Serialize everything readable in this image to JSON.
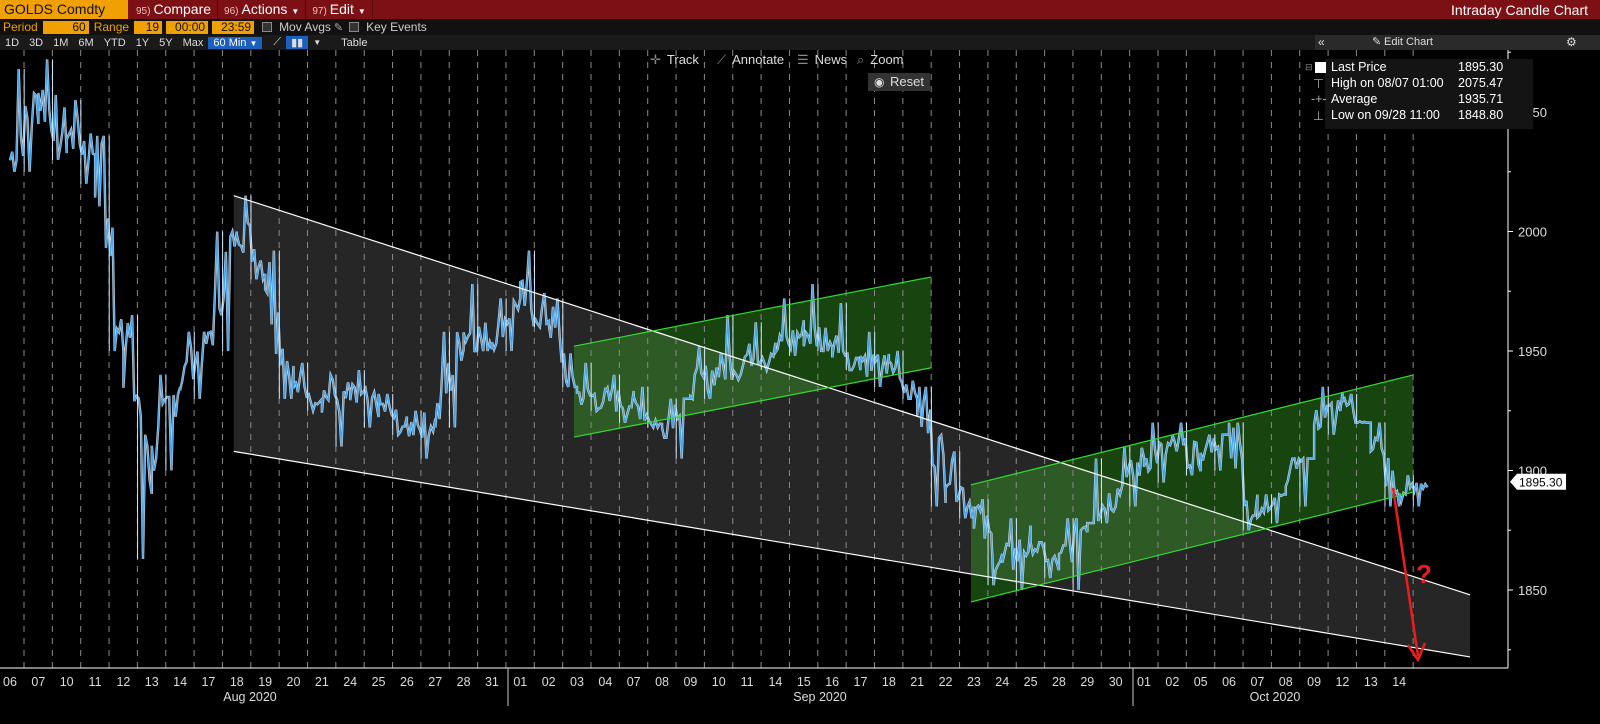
{
  "toolbar": {
    "ticker": "GOLDS Comdty",
    "compare_num": "95)",
    "compare_label": "Compare",
    "actions_num": "96)",
    "actions_label": "Actions",
    "edit_num": "97)",
    "edit_label": "Edit",
    "chart_name": "Intraday Candle Chart"
  },
  "settings": {
    "period_label": "Period",
    "period_value": "60",
    "range_label": "Range",
    "range_value": "19",
    "time_start": "00:00",
    "time_end": "23:59",
    "mov_avgs": "Mov Avgs",
    "key_events": "Key Events"
  },
  "ranges": [
    "1D",
    "3D",
    "1M",
    "6M",
    "YTD",
    "1Y",
    "5Y",
    "Max"
  ],
  "selected_range": "60 Min",
  "table_label": "Table",
  "edit_chart_label": "Edit Chart",
  "tools": {
    "track": "Track",
    "annotate": "Annotate",
    "news": "News",
    "zoom": "Zoom",
    "reset": "Reset"
  },
  "legend": {
    "last_label": "Last Price",
    "last_value": "1895.30",
    "high_label": "High on 08/07 01:00",
    "high_value": "2075.47",
    "avg_label": "Average",
    "avg_value": "1935.71",
    "low_label": "Low on 09/28 11:00",
    "low_value": "1848.80"
  },
  "annotation_mark": "?",
  "colors": {
    "price_line": "#4aa3e8",
    "highlight": "#ffffff",
    "channel_main": "#ffffff",
    "channel_green": "#33dd33",
    "arrow": "#ee1c1c",
    "toolbar_bg": "#7d1014",
    "accent": "#f0a000"
  },
  "chart_data": {
    "type": "line",
    "ylim": [
      1820,
      2075
    ],
    "yticks": [
      1850,
      1900,
      1950,
      2000,
      2050
    ],
    "last_price": 1895.3,
    "months": [
      "Aug 2020",
      "Sep 2020",
      "Oct 2020"
    ],
    "x": [
      "06",
      "07",
      "10",
      "11",
      "12",
      "13",
      "14",
      "17",
      "18",
      "19",
      "20",
      "21",
      "24",
      "25",
      "26",
      "27",
      "28",
      "31",
      "01",
      "02",
      "03",
      "04",
      "07",
      "08",
      "09",
      "10",
      "11",
      "14",
      "15",
      "16",
      "17",
      "18",
      "21",
      "22",
      "23",
      "24",
      "25",
      "28",
      "29",
      "30",
      "01",
      "02",
      "05",
      "06",
      "07",
      "08",
      "09",
      "12",
      "13",
      "14"
    ],
    "open": [
      2030,
      2058,
      2040,
      2035,
      1960,
      1905,
      1938,
      1955,
      2005,
      1985,
      1935,
      1932,
      1930,
      1928,
      1918,
      1920,
      1958,
      1955,
      1972,
      1965,
      1932,
      1930,
      1928,
      1918,
      1935,
      1942,
      1948,
      1950,
      1958,
      1955,
      1942,
      1945,
      1930,
      1900,
      1885,
      1860,
      1870,
      1860,
      1880,
      1890,
      1905,
      1910,
      1905,
      1918,
      1880,
      1895,
      1920,
      1928,
      1915,
      1888
    ],
    "high": [
      2068,
      2072,
      2055,
      2040,
      1965,
      1940,
      1958,
      2000,
      2015,
      1992,
      1945,
      1940,
      1942,
      1932,
      1925,
      1958,
      1978,
      1972,
      1992,
      1972,
      1945,
      1940,
      1935,
      1930,
      1952,
      1965,
      1962,
      1972,
      1978,
      1970,
      1958,
      1950,
      1935,
      1908,
      1888,
      1880,
      1870,
      1880,
      1905,
      1910,
      1920,
      1920,
      1915,
      1920,
      1890,
      1905,
      1935,
      1932,
      1920,
      1898
    ],
    "low": [
      2025,
      2030,
      2020,
      1950,
      1863,
      1900,
      1930,
      1950,
      1980,
      1930,
      1925,
      1910,
      1918,
      1915,
      1905,
      1918,
      1950,
      1950,
      1960,
      1935,
      1925,
      1920,
      1918,
      1905,
      1930,
      1938,
      1942,
      1948,
      1950,
      1942,
      1935,
      1930,
      1885,
      1880,
      1852,
      1850,
      1855,
      1850,
      1878,
      1885,
      1895,
      1898,
      1900,
      1875,
      1878,
      1885,
      1915,
      1920,
      1885,
      1885
    ],
    "close": [
      2055,
      2040,
      2035,
      1960,
      1905,
      1938,
      1955,
      2005,
      1985,
      1935,
      1932,
      1930,
      1928,
      1918,
      1920,
      1958,
      1955,
      1972,
      1965,
      1932,
      1930,
      1928,
      1918,
      1935,
      1942,
      1948,
      1950,
      1958,
      1955,
      1942,
      1945,
      1930,
      1900,
      1885,
      1860,
      1870,
      1860,
      1880,
      1890,
      1905,
      1910,
      1905,
      1918,
      1880,
      1895,
      1920,
      1928,
      1915,
      1888,
      1895.3
    ],
    "channels": [
      {
        "name": "",
        "style": "white",
        "start": {
          "x": "18",
          "y": 2015
        },
        "end": {
          "x": "14",
          "y": 1848
        },
        "lower_start": 1908,
        "lower_end": 1822
      },
      {
        "name": "",
        "style": "green",
        "start": {
          "x": "03",
          "y": 1952
        },
        "end": {
          "x": "18",
          "y": 1981
        },
        "lower_start": 1914,
        "lower_end": 1943
      },
      {
        "name": "",
        "style": "green",
        "start": {
          "x": "23",
          "y": 1894
        },
        "end": {
          "x": "14",
          "y": 1940
        },
        "lower_start": 1845,
        "lower_end": 1891
      }
    ]
  }
}
